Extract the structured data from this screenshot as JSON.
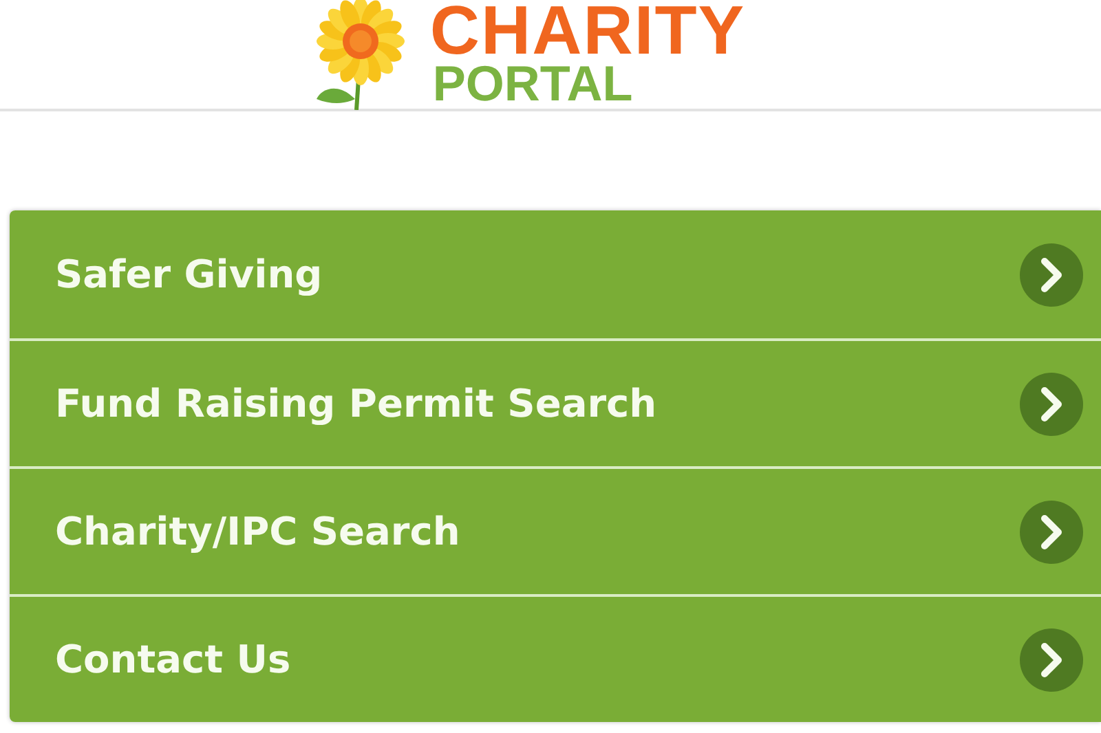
{
  "header": {
    "logo_title": "CHARITY",
    "logo_subtitle": "PORTAL"
  },
  "menu": [
    {
      "label": "Safer Giving"
    },
    {
      "label": "Fund Raising Permit Search"
    },
    {
      "label": "Charity/IPC Search"
    },
    {
      "label": "Contact Us"
    }
  ]
}
